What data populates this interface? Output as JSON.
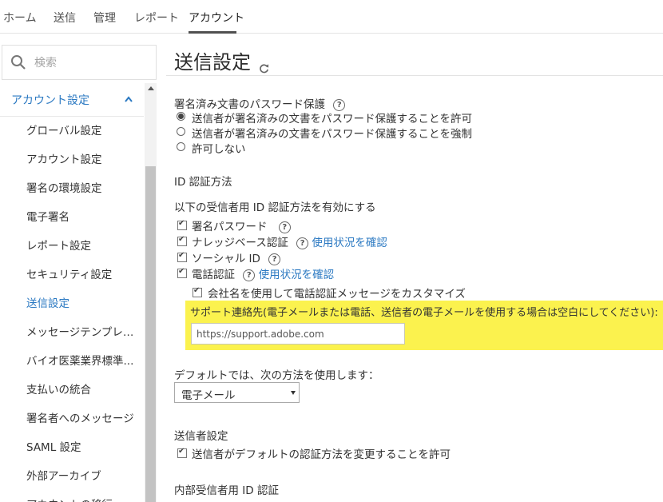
{
  "topnav": {
    "tabs": [
      {
        "label": "ホーム"
      },
      {
        "label": "送信"
      },
      {
        "label": "管理"
      },
      {
        "label": "レポート"
      },
      {
        "label": "アカウント"
      }
    ]
  },
  "sidebar": {
    "search_placeholder": "検索",
    "section_title": "アカウント設定",
    "items": [
      {
        "label": "グローバル設定"
      },
      {
        "label": "アカウント設定"
      },
      {
        "label": "署名の環境設定"
      },
      {
        "label": "電子署名"
      },
      {
        "label": "レポート設定"
      },
      {
        "label": "セキュリティ設定"
      },
      {
        "label": "送信設定"
      },
      {
        "label": "メッセージテンプレート"
      },
      {
        "label": "バイオ医薬業界標準..."
      },
      {
        "label": "支払いの統合"
      },
      {
        "label": "署名者へのメッセージ"
      },
      {
        "label": "SAML 設定"
      },
      {
        "label": "外部アーカイブ"
      },
      {
        "label": "アカウントの移行"
      }
    ]
  },
  "main": {
    "title": "送信設定",
    "password_section": {
      "title": "署名済み文書のパスワード保護",
      "options": [
        {
          "label": "送信者が署名済みの文書をパスワード保護することを許可"
        },
        {
          "label": "送信者が署名済みの文書をパスワード保護することを強制"
        },
        {
          "label": "許可しない"
        }
      ]
    },
    "id_auth": {
      "title": "ID 認証方法",
      "enable_label": "以下の受信者用 ID 認証方法を有効にする",
      "methods": [
        {
          "label": "署名パスワード"
        },
        {
          "label": "ナレッジベース認証",
          "link": "使用状況を確認"
        },
        {
          "label": "ソーシャル ID"
        },
        {
          "label": "電話認証",
          "link": "使用状況を確認"
        }
      ],
      "customize_label": "会社名を使用して電話認証メッセージをカスタマイズ",
      "support_label": "サポート連絡先(電子メールまたは電話、送信者の電子メールを使用する場合は空白にしてください):",
      "support_value": "https://support.adobe.com",
      "default_label": "デフォルトでは、次の方法を使用します：",
      "default_value": "電子メール"
    },
    "sender_settings": {
      "title": "送信者設定",
      "allow_label": "送信者がデフォルトの認証方法を変更することを許可"
    },
    "internal": {
      "title": "内部受信者用 ID 認証"
    },
    "help_glyph": "?"
  }
}
